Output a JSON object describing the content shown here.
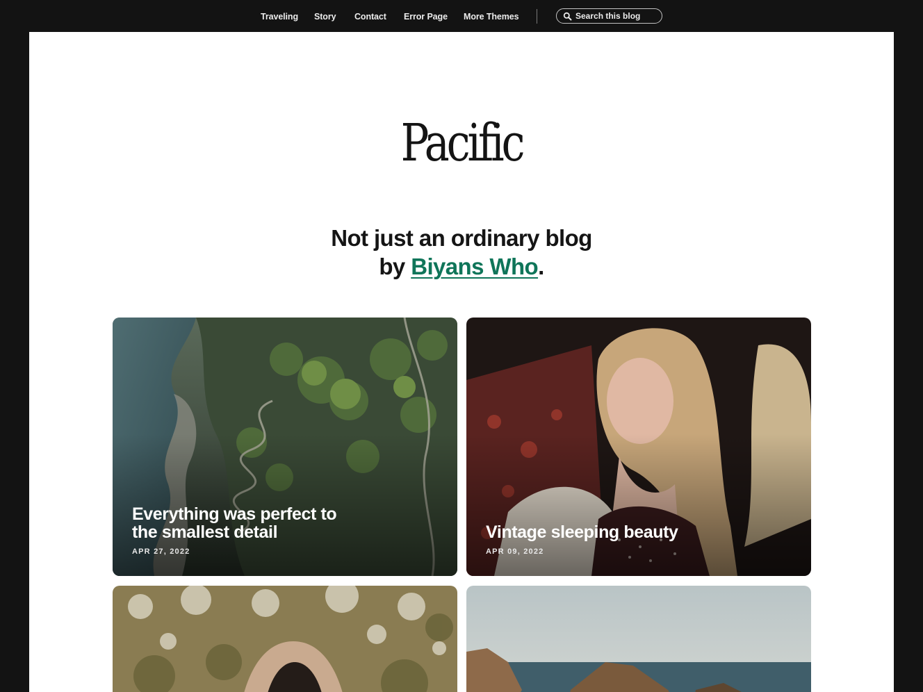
{
  "nav": {
    "items": [
      {
        "label": "Traveling"
      },
      {
        "label": "Story"
      },
      {
        "label": "Contact"
      },
      {
        "label": "Error Page"
      },
      {
        "label": "More Themes"
      }
    ],
    "search": {
      "label": "Search this blog",
      "icon": "search-icon"
    }
  },
  "site": {
    "logo": "Pacific",
    "tagline_line1": "Not just an ordinary blog",
    "tagline_prefix": "by ",
    "author": "Biyans Who",
    "tagline_suffix": ".",
    "accent_color": "#0f7559"
  },
  "posts": [
    {
      "title": "Everything was perfect to the smallest detail",
      "date": "APR 27, 2022"
    },
    {
      "title": "Vintage sleeping beauty",
      "date": "APR 09, 2022"
    },
    {
      "title": "",
      "date": ""
    },
    {
      "title": "",
      "date": ""
    }
  ],
  "colors": {
    "page_background": "#131313",
    "content_background": "#ffffff"
  }
}
